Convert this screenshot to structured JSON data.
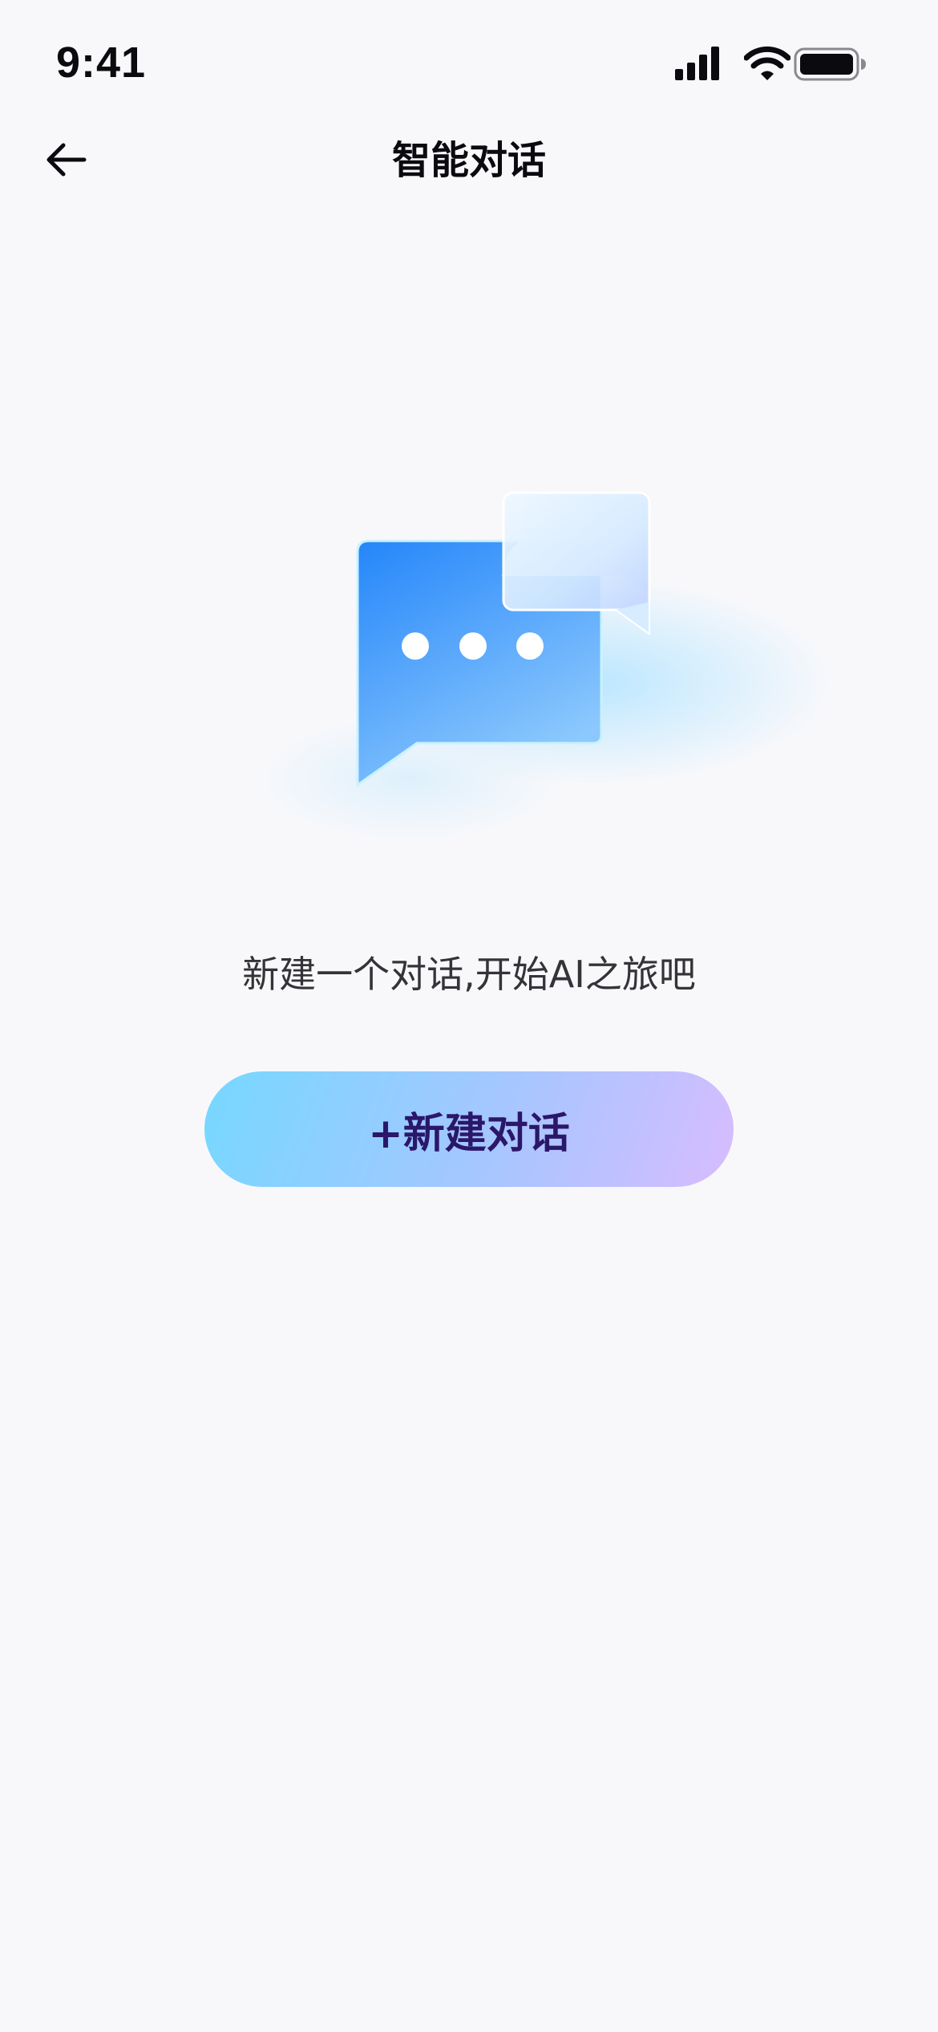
{
  "status_bar": {
    "time": "9:41",
    "icons": [
      "cellular-signal-icon",
      "wifi-icon",
      "battery-icon"
    ]
  },
  "nav": {
    "back_icon": "arrow-left-icon",
    "title": "智能对话"
  },
  "empty_state": {
    "illustration": "chat-bubbles-illustration",
    "message": "新建一个对话,开始AI之旅吧",
    "button_label": "+新建对话"
  },
  "colors": {
    "background": "#f8f8fb",
    "text_primary": "#0b0b0f",
    "text_secondary": "#333338",
    "bubble_blue": "#2f8dfc",
    "button_gradient": [
      "#76d8ff",
      "#a6c6ff",
      "#d7bcff"
    ],
    "button_text": "#2b1769"
  }
}
